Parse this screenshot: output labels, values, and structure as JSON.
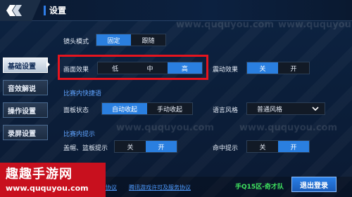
{
  "header": {
    "title": "设置"
  },
  "sidebar": {
    "items": [
      {
        "label": "基础设置",
        "active": true
      },
      {
        "label": "音效解说",
        "active": false
      },
      {
        "label": "操作设置",
        "active": false
      },
      {
        "label": "录屏设置",
        "active": false
      }
    ]
  },
  "settings": {
    "camera_mode": {
      "label": "镜头模式",
      "options": [
        "固定",
        "跟随"
      ],
      "selected": "固定"
    },
    "graphics": {
      "label": "画面效果",
      "options": [
        "低",
        "中",
        "高"
      ],
      "selected": "高"
    },
    "vibration": {
      "label": "震动效果",
      "options": [
        "关",
        "开"
      ],
      "selected": "关"
    },
    "quick_chat_section": "比赛内快捷语",
    "panel_state": {
      "label": "面板状态",
      "options": [
        "自动收起",
        "手动收起"
      ],
      "selected": "自动收起"
    },
    "voice_style": {
      "label": "语言风格",
      "value": "普通风格"
    },
    "hints_section": "比赛内提示",
    "cap_block": {
      "label": "盖帽、篮板提示",
      "options": [
        "关",
        "开"
      ],
      "selected": "开"
    },
    "hit_hint": {
      "label": "命中提示",
      "options": [
        "关",
        "开"
      ],
      "selected": "开"
    }
  },
  "footer": {
    "link_left": "协议",
    "link_mid": "腾讯游戏许可及服务协议",
    "server": "手Q15区-奇才队",
    "logout_label": "退出登录"
  },
  "watermark": {
    "brand": "趣趣手游网",
    "url": "www.ququyou.com"
  },
  "colors": {
    "accent": "#2a7fe0",
    "highlight": "#e6141e",
    "section": "#5fa3ff",
    "server_green": "#3fe35f"
  }
}
